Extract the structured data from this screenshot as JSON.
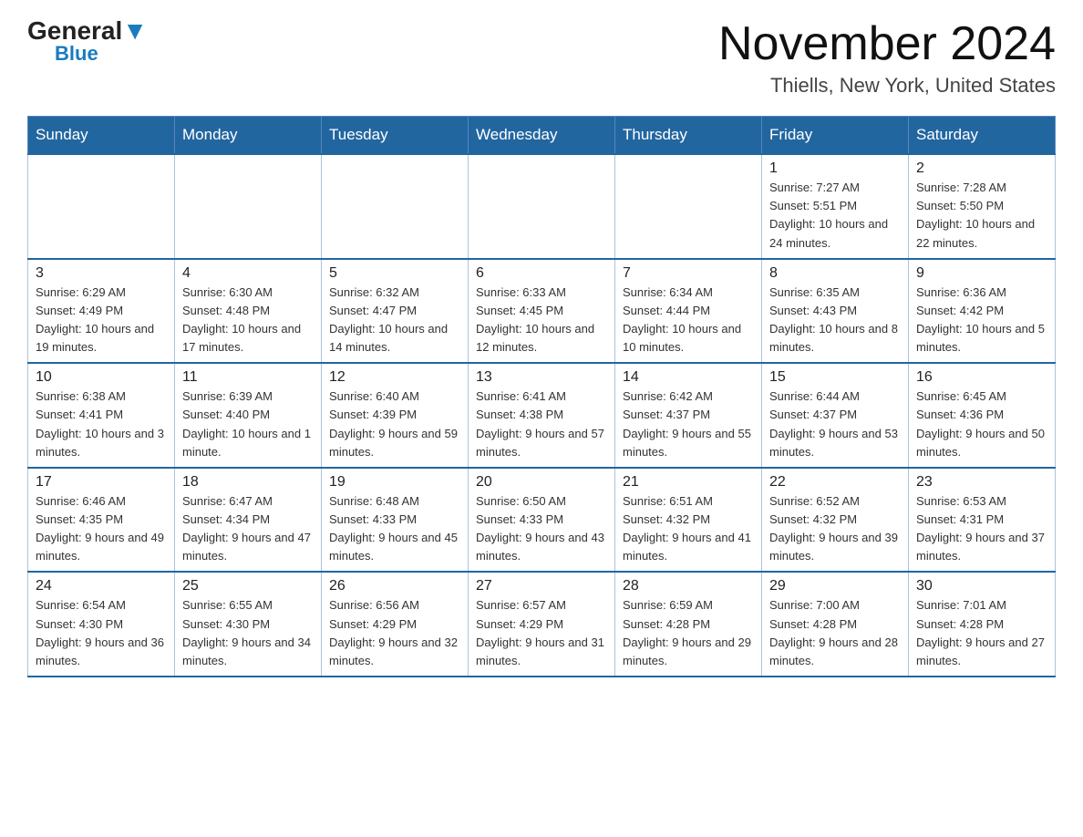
{
  "header": {
    "logo_general": "General",
    "logo_blue": "Blue",
    "month_title": "November 2024",
    "location": "Thiells, New York, United States"
  },
  "days_of_week": [
    "Sunday",
    "Monday",
    "Tuesday",
    "Wednesday",
    "Thursday",
    "Friday",
    "Saturday"
  ],
  "weeks": [
    [
      {
        "day": "",
        "info": ""
      },
      {
        "day": "",
        "info": ""
      },
      {
        "day": "",
        "info": ""
      },
      {
        "day": "",
        "info": ""
      },
      {
        "day": "",
        "info": ""
      },
      {
        "day": "1",
        "info": "Sunrise: 7:27 AM\nSunset: 5:51 PM\nDaylight: 10 hours and 24 minutes."
      },
      {
        "day": "2",
        "info": "Sunrise: 7:28 AM\nSunset: 5:50 PM\nDaylight: 10 hours and 22 minutes."
      }
    ],
    [
      {
        "day": "3",
        "info": "Sunrise: 6:29 AM\nSunset: 4:49 PM\nDaylight: 10 hours and 19 minutes."
      },
      {
        "day": "4",
        "info": "Sunrise: 6:30 AM\nSunset: 4:48 PM\nDaylight: 10 hours and 17 minutes."
      },
      {
        "day": "5",
        "info": "Sunrise: 6:32 AM\nSunset: 4:47 PM\nDaylight: 10 hours and 14 minutes."
      },
      {
        "day": "6",
        "info": "Sunrise: 6:33 AM\nSunset: 4:45 PM\nDaylight: 10 hours and 12 minutes."
      },
      {
        "day": "7",
        "info": "Sunrise: 6:34 AM\nSunset: 4:44 PM\nDaylight: 10 hours and 10 minutes."
      },
      {
        "day": "8",
        "info": "Sunrise: 6:35 AM\nSunset: 4:43 PM\nDaylight: 10 hours and 8 minutes."
      },
      {
        "day": "9",
        "info": "Sunrise: 6:36 AM\nSunset: 4:42 PM\nDaylight: 10 hours and 5 minutes."
      }
    ],
    [
      {
        "day": "10",
        "info": "Sunrise: 6:38 AM\nSunset: 4:41 PM\nDaylight: 10 hours and 3 minutes."
      },
      {
        "day": "11",
        "info": "Sunrise: 6:39 AM\nSunset: 4:40 PM\nDaylight: 10 hours and 1 minute."
      },
      {
        "day": "12",
        "info": "Sunrise: 6:40 AM\nSunset: 4:39 PM\nDaylight: 9 hours and 59 minutes."
      },
      {
        "day": "13",
        "info": "Sunrise: 6:41 AM\nSunset: 4:38 PM\nDaylight: 9 hours and 57 minutes."
      },
      {
        "day": "14",
        "info": "Sunrise: 6:42 AM\nSunset: 4:37 PM\nDaylight: 9 hours and 55 minutes."
      },
      {
        "day": "15",
        "info": "Sunrise: 6:44 AM\nSunset: 4:37 PM\nDaylight: 9 hours and 53 minutes."
      },
      {
        "day": "16",
        "info": "Sunrise: 6:45 AM\nSunset: 4:36 PM\nDaylight: 9 hours and 50 minutes."
      }
    ],
    [
      {
        "day": "17",
        "info": "Sunrise: 6:46 AM\nSunset: 4:35 PM\nDaylight: 9 hours and 49 minutes."
      },
      {
        "day": "18",
        "info": "Sunrise: 6:47 AM\nSunset: 4:34 PM\nDaylight: 9 hours and 47 minutes."
      },
      {
        "day": "19",
        "info": "Sunrise: 6:48 AM\nSunset: 4:33 PM\nDaylight: 9 hours and 45 minutes."
      },
      {
        "day": "20",
        "info": "Sunrise: 6:50 AM\nSunset: 4:33 PM\nDaylight: 9 hours and 43 minutes."
      },
      {
        "day": "21",
        "info": "Sunrise: 6:51 AM\nSunset: 4:32 PM\nDaylight: 9 hours and 41 minutes."
      },
      {
        "day": "22",
        "info": "Sunrise: 6:52 AM\nSunset: 4:32 PM\nDaylight: 9 hours and 39 minutes."
      },
      {
        "day": "23",
        "info": "Sunrise: 6:53 AM\nSunset: 4:31 PM\nDaylight: 9 hours and 37 minutes."
      }
    ],
    [
      {
        "day": "24",
        "info": "Sunrise: 6:54 AM\nSunset: 4:30 PM\nDaylight: 9 hours and 36 minutes."
      },
      {
        "day": "25",
        "info": "Sunrise: 6:55 AM\nSunset: 4:30 PM\nDaylight: 9 hours and 34 minutes."
      },
      {
        "day": "26",
        "info": "Sunrise: 6:56 AM\nSunset: 4:29 PM\nDaylight: 9 hours and 32 minutes."
      },
      {
        "day": "27",
        "info": "Sunrise: 6:57 AM\nSunset: 4:29 PM\nDaylight: 9 hours and 31 minutes."
      },
      {
        "day": "28",
        "info": "Sunrise: 6:59 AM\nSunset: 4:28 PM\nDaylight: 9 hours and 29 minutes."
      },
      {
        "day": "29",
        "info": "Sunrise: 7:00 AM\nSunset: 4:28 PM\nDaylight: 9 hours and 28 minutes."
      },
      {
        "day": "30",
        "info": "Sunrise: 7:01 AM\nSunset: 4:28 PM\nDaylight: 9 hours and 27 minutes."
      }
    ]
  ]
}
